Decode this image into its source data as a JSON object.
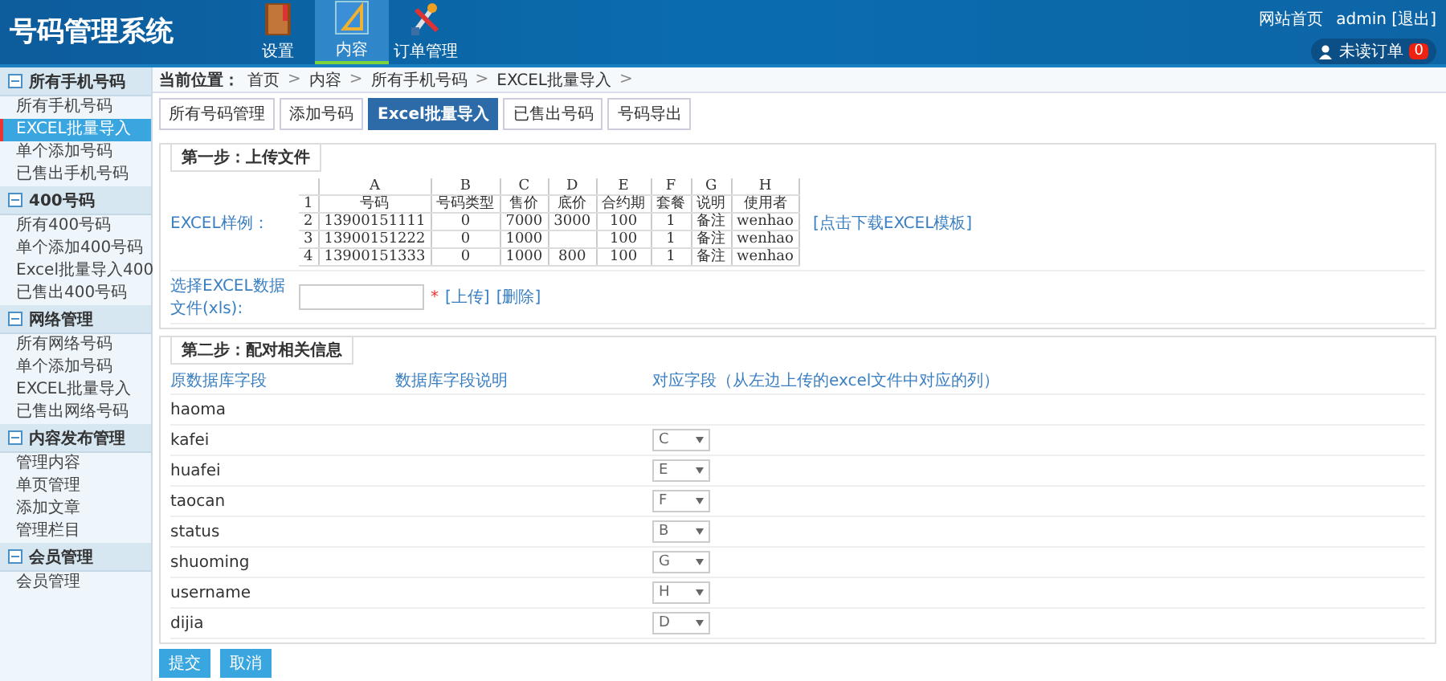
{
  "header": {
    "title": "号码管理系统",
    "nav": [
      {
        "label": "设置",
        "kind": "book",
        "selected": false
      },
      {
        "label": "内容",
        "kind": "ruler",
        "selected": true
      },
      {
        "label": "订单管理",
        "kind": "tools",
        "selected": false
      }
    ],
    "links": [
      "网站首页",
      "admin [退出]"
    ],
    "orders": {
      "label": "未读订单",
      "count": "0"
    }
  },
  "sidebar": [
    {
      "title": "所有手机号码",
      "items": [
        {
          "label": "所有手机号码",
          "selected": false
        },
        {
          "label": "EXCEL批量导入",
          "selected": true
        },
        {
          "label": "单个添加号码",
          "selected": false
        },
        {
          "label": "已售出手机号码",
          "selected": false
        }
      ]
    },
    {
      "title": "400号码",
      "items": [
        {
          "label": "所有400号码",
          "selected": false
        },
        {
          "label": "单个添加400号码",
          "selected": false
        },
        {
          "label": "Excel批量导入400",
          "selected": false
        },
        {
          "label": "已售出400号码",
          "selected": false
        }
      ]
    },
    {
      "title": "网络管理",
      "items": [
        {
          "label": "所有网络号码",
          "selected": false
        },
        {
          "label": "单个添加号码",
          "selected": false
        },
        {
          "label": "EXCEL批量导入",
          "selected": false
        },
        {
          "label": "已售出网络号码",
          "selected": false
        }
      ]
    },
    {
      "title": "内容发布管理",
      "items": [
        {
          "label": "管理内容",
          "selected": false
        },
        {
          "label": "单页管理",
          "selected": false
        },
        {
          "label": "添加文章",
          "selected": false
        },
        {
          "label": "管理栏目",
          "selected": false
        }
      ]
    },
    {
      "title": "会员管理",
      "items": [
        {
          "label": "会员管理",
          "selected": false
        }
      ]
    }
  ],
  "breadcrumb": {
    "label": "当前位置：",
    "items": [
      "首页",
      "内容",
      "所有手机号码",
      "EXCEL批量导入"
    ],
    "separator": ">"
  },
  "tabs": [
    {
      "label": "所有号码管理",
      "selected": false
    },
    {
      "label": "添加号码",
      "selected": false
    },
    {
      "label": "Excel批量导入",
      "selected": true
    },
    {
      "label": "已售出号码",
      "selected": false
    },
    {
      "label": "号码导出",
      "selected": false
    }
  ],
  "step1": {
    "legend": "第一步：上传文件",
    "sample_label": "EXCEL样例：",
    "sample": {
      "columns": [
        "A",
        "B",
        "C",
        "D",
        "E",
        "F",
        "G",
        "H"
      ],
      "rows": [
        {
          "num": "1",
          "cells": [
            "号码",
            "号码类型",
            "售价",
            "底价",
            "合约期",
            "套餐",
            "说明",
            "使用者"
          ]
        },
        {
          "num": "2",
          "cells": [
            "13900151111",
            "0",
            "7000",
            "3000",
            "100",
            "1",
            "备注",
            "wenhao"
          ]
        },
        {
          "num": "3",
          "cells": [
            "13900151222",
            "0",
            "1000",
            "",
            "100",
            "1",
            "备注",
            "wenhao"
          ]
        },
        {
          "num": "4",
          "cells": [
            "13900151333",
            "0",
            "1000",
            "800",
            "100",
            "1",
            "备注",
            "wenhao"
          ]
        }
      ]
    },
    "download": "[点击下载EXCEL模板]",
    "file_label": "选择EXCEL数据文件(xls):",
    "required": "*",
    "actions": [
      "[上传]",
      "[删除]"
    ]
  },
  "step2": {
    "legend": "第二步：配对相关信息",
    "columns": [
      "原数据库字段",
      "数据库字段说明",
      "对应字段（从左边上传的excel文件中对应的列）"
    ],
    "rows": [
      {
        "field": "haoma"
      },
      {
        "field": "kafei",
        "column": "C"
      },
      {
        "field": "huafei",
        "column": "E"
      },
      {
        "field": "taocan",
        "column": "F"
      },
      {
        "field": "status",
        "column": "B"
      },
      {
        "field": "shuoming",
        "column": "G"
      },
      {
        "field": "username",
        "column": "H"
      },
      {
        "field": "dijia",
        "column": "D"
      }
    ]
  },
  "buttons": [
    "提交",
    "取消"
  ]
}
